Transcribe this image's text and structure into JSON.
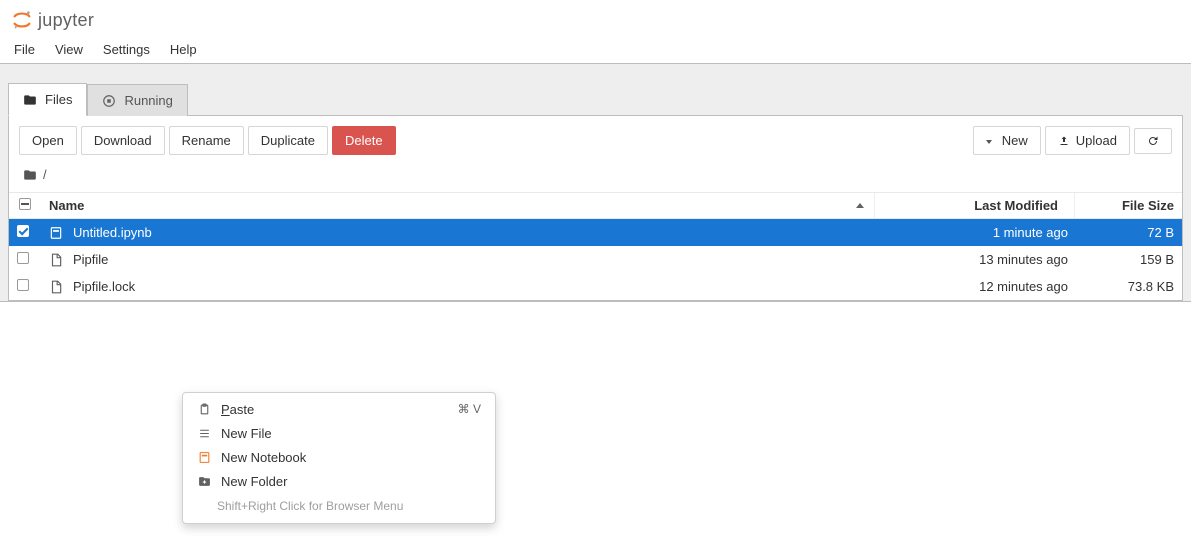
{
  "logo": {
    "text": "jupyter"
  },
  "menu": {
    "items": [
      "File",
      "View",
      "Settings",
      "Help"
    ]
  },
  "tabs": {
    "items": [
      {
        "label": "Files",
        "active": true,
        "icon": "folder"
      },
      {
        "label": "Running",
        "active": false,
        "icon": "stop-circle"
      }
    ]
  },
  "toolbar": {
    "open": "Open",
    "download": "Download",
    "rename": "Rename",
    "duplicate": "Duplicate",
    "delete": "Delete",
    "new": "New",
    "upload": "Upload"
  },
  "breadcrumb": {
    "root": "/"
  },
  "table": {
    "headers": {
      "name": "Name",
      "modified": "Last Modified",
      "size": "File Size"
    },
    "rows": [
      {
        "name": "Untitled.ipynb",
        "modified": "1 minute ago",
        "size": "72 B",
        "selected": true,
        "icon": "notebook"
      },
      {
        "name": "Pipfile",
        "modified": "13 minutes ago",
        "size": "159 B",
        "selected": false,
        "icon": "file"
      },
      {
        "name": "Pipfile.lock",
        "modified": "12 minutes ago",
        "size": "73.8 KB",
        "selected": false,
        "icon": "file"
      }
    ]
  },
  "context_menu": {
    "items": [
      {
        "label": "Paste",
        "shortcut": "⌘ V",
        "icon": "clipboard",
        "underline_first": true
      },
      {
        "label": "New File",
        "shortcut": "",
        "icon": "list",
        "underline_first": false
      },
      {
        "label": "New Notebook",
        "shortcut": "",
        "icon": "notebook-orange",
        "underline_first": false
      },
      {
        "label": "New Folder",
        "shortcut": "",
        "icon": "folder-plus",
        "underline_first": false
      }
    ],
    "hint": "Shift+Right Click for Browser Menu"
  }
}
